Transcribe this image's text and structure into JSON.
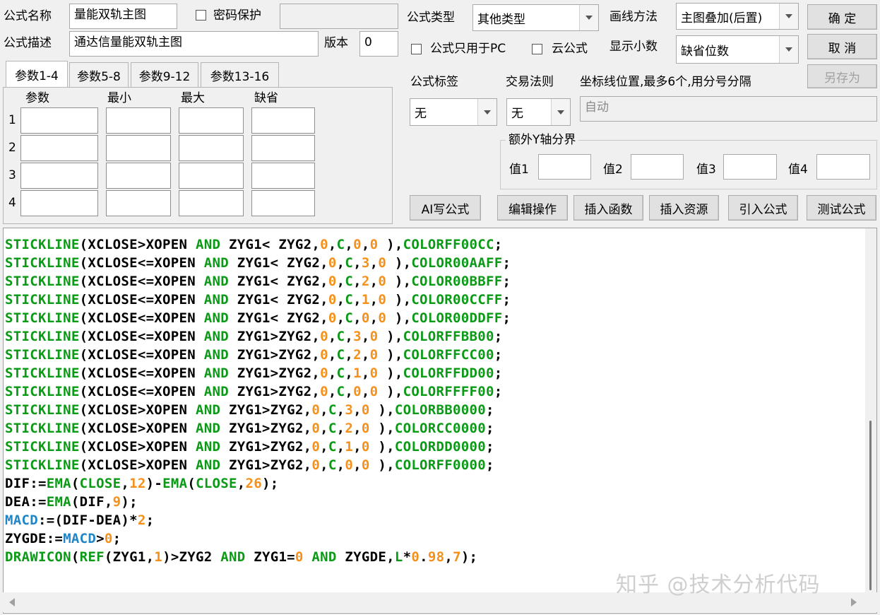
{
  "form": {
    "name_label": "公式名称",
    "name_value": "量能双轨主图",
    "password_label": "密码保护",
    "desc_label": "公式描述",
    "desc_value": "通达信量能双轨主图",
    "version_label": "版本",
    "version_value": "0",
    "type_label": "公式类型",
    "type_value": "其他类型",
    "draw_label": "画线方法",
    "draw_value": "主图叠加(后置)",
    "pc_only_label": "公式只用于PC",
    "cloud_label": "云公式",
    "decimals_label": "显示小数",
    "decimals_value": "缺省位数",
    "tag_label": "公式标签",
    "tag_value": "无",
    "rule_label": "交易法则",
    "rule_value": "无",
    "coord_label": "坐标线位置,最多6个,用分号分隔",
    "coord_placeholder": "自动",
    "extra_y_label": "额外Y轴分界",
    "val_labels": [
      "值1",
      "值2",
      "值3",
      "值4"
    ]
  },
  "buttons": {
    "ok": "确  定",
    "cancel": "取  消",
    "save_as": "另存为",
    "ai_write": "AI写公式",
    "edit_ops": "编辑操作",
    "insert_func": "插入函数",
    "insert_res": "插入资源",
    "import_formula": "引入公式",
    "test_formula": "测试公式"
  },
  "param_tabs": [
    "参数1-4",
    "参数5-8",
    "参数9-12",
    "参数13-16"
  ],
  "param_headers": [
    "参数",
    "最小",
    "最大",
    "缺省"
  ],
  "param_rows": [
    "1",
    "2",
    "3",
    "4"
  ],
  "colors": {
    "keyword": "#0a9a16",
    "number": "#f5901a",
    "text": "#000000",
    "variable": "#1f86c8"
  },
  "code_lines": [
    [
      [
        "g",
        "STICKLINE"
      ],
      [
        "k",
        "(XCLOSE>XOPEN "
      ],
      [
        "g",
        "AND"
      ],
      [
        "k",
        " ZYG1< ZYG2,"
      ],
      [
        "o",
        "0"
      ],
      [
        "k",
        ","
      ],
      [
        "g",
        "C"
      ],
      [
        "k",
        ","
      ],
      [
        "o",
        "0"
      ],
      [
        "k",
        ","
      ],
      [
        "o",
        "0"
      ],
      [
        "k",
        " ),"
      ],
      [
        "g",
        "COLORFF00CC"
      ],
      [
        "k",
        ";"
      ]
    ],
    [
      [
        "g",
        "STICKLINE"
      ],
      [
        "k",
        "(XCLOSE<=XOPEN "
      ],
      [
        "g",
        "AND"
      ],
      [
        "k",
        " ZYG1< ZYG2,"
      ],
      [
        "o",
        "0"
      ],
      [
        "k",
        ","
      ],
      [
        "g",
        "C"
      ],
      [
        "k",
        ","
      ],
      [
        "o",
        "3"
      ],
      [
        "k",
        ","
      ],
      [
        "o",
        "0"
      ],
      [
        "k",
        " ),"
      ],
      [
        "g",
        "COLOR00AAFF"
      ],
      [
        "k",
        ";"
      ]
    ],
    [
      [
        "g",
        "STICKLINE"
      ],
      [
        "k",
        "(XCLOSE<=XOPEN "
      ],
      [
        "g",
        "AND"
      ],
      [
        "k",
        " ZYG1< ZYG2,"
      ],
      [
        "o",
        "0"
      ],
      [
        "k",
        ","
      ],
      [
        "g",
        "C"
      ],
      [
        "k",
        ","
      ],
      [
        "o",
        "2"
      ],
      [
        "k",
        ","
      ],
      [
        "o",
        "0"
      ],
      [
        "k",
        " ),"
      ],
      [
        "g",
        "COLOR00BBFF"
      ],
      [
        "k",
        ";"
      ]
    ],
    [
      [
        "g",
        "STICKLINE"
      ],
      [
        "k",
        "(XCLOSE<=XOPEN "
      ],
      [
        "g",
        "AND"
      ],
      [
        "k",
        " ZYG1< ZYG2,"
      ],
      [
        "o",
        "0"
      ],
      [
        "k",
        ","
      ],
      [
        "g",
        "C"
      ],
      [
        "k",
        ","
      ],
      [
        "o",
        "1"
      ],
      [
        "k",
        ","
      ],
      [
        "o",
        "0"
      ],
      [
        "k",
        " ),"
      ],
      [
        "g",
        "COLOR00CCFF"
      ],
      [
        "k",
        ";"
      ]
    ],
    [
      [
        "g",
        "STICKLINE"
      ],
      [
        "k",
        "(XCLOSE<=XOPEN "
      ],
      [
        "g",
        "AND"
      ],
      [
        "k",
        " ZYG1< ZYG2,"
      ],
      [
        "o",
        "0"
      ],
      [
        "k",
        ","
      ],
      [
        "g",
        "C"
      ],
      [
        "k",
        ","
      ],
      [
        "o",
        "0"
      ],
      [
        "k",
        ","
      ],
      [
        "o",
        "0"
      ],
      [
        "k",
        " ),"
      ],
      [
        "g",
        "COLOR00DDFF"
      ],
      [
        "k",
        ";"
      ]
    ],
    [
      [
        "g",
        "STICKLINE"
      ],
      [
        "k",
        "(XCLOSE<=XOPEN "
      ],
      [
        "g",
        "AND"
      ],
      [
        "k",
        " ZYG1>ZYG2,"
      ],
      [
        "o",
        "0"
      ],
      [
        "k",
        ","
      ],
      [
        "g",
        "C"
      ],
      [
        "k",
        ","
      ],
      [
        "o",
        "3"
      ],
      [
        "k",
        ","
      ],
      [
        "o",
        "0"
      ],
      [
        "k",
        " ),"
      ],
      [
        "g",
        "COLORFFBB00"
      ],
      [
        "k",
        ";"
      ]
    ],
    [
      [
        "g",
        "STICKLINE"
      ],
      [
        "k",
        "(XCLOSE<=XOPEN "
      ],
      [
        "g",
        "AND"
      ],
      [
        "k",
        " ZYG1>ZYG2,"
      ],
      [
        "o",
        "0"
      ],
      [
        "k",
        ","
      ],
      [
        "g",
        "C"
      ],
      [
        "k",
        ","
      ],
      [
        "o",
        "2"
      ],
      [
        "k",
        ","
      ],
      [
        "o",
        "0"
      ],
      [
        "k",
        " ),"
      ],
      [
        "g",
        "COLORFFCC00"
      ],
      [
        "k",
        ";"
      ]
    ],
    [
      [
        "g",
        "STICKLINE"
      ],
      [
        "k",
        "(XCLOSE<=XOPEN "
      ],
      [
        "g",
        "AND"
      ],
      [
        "k",
        " ZYG1>ZYG2,"
      ],
      [
        "o",
        "0"
      ],
      [
        "k",
        ","
      ],
      [
        "g",
        "C"
      ],
      [
        "k",
        ","
      ],
      [
        "o",
        "1"
      ],
      [
        "k",
        ","
      ],
      [
        "o",
        "0"
      ],
      [
        "k",
        " ),"
      ],
      [
        "g",
        "COLORFFDD00"
      ],
      [
        "k",
        ";"
      ]
    ],
    [
      [
        "g",
        "STICKLINE"
      ],
      [
        "k",
        "(XCLOSE<=XOPEN "
      ],
      [
        "g",
        "AND"
      ],
      [
        "k",
        " ZYG1>ZYG2,"
      ],
      [
        "o",
        "0"
      ],
      [
        "k",
        ","
      ],
      [
        "g",
        "C"
      ],
      [
        "k",
        ","
      ],
      [
        "o",
        "0"
      ],
      [
        "k",
        ","
      ],
      [
        "o",
        "0"
      ],
      [
        "k",
        " ),"
      ],
      [
        "g",
        "COLORFFFF00"
      ],
      [
        "k",
        ";"
      ]
    ],
    [
      [
        "g",
        "STICKLINE"
      ],
      [
        "k",
        "(XCLOSE>XOPEN "
      ],
      [
        "g",
        "AND"
      ],
      [
        "k",
        " ZYG1>ZYG2,"
      ],
      [
        "o",
        "0"
      ],
      [
        "k",
        ","
      ],
      [
        "g",
        "C"
      ],
      [
        "k",
        ","
      ],
      [
        "o",
        "3"
      ],
      [
        "k",
        ","
      ],
      [
        "o",
        "0"
      ],
      [
        "k",
        " ),"
      ],
      [
        "g",
        "COLORBB0000"
      ],
      [
        "k",
        ";"
      ]
    ],
    [
      [
        "g",
        "STICKLINE"
      ],
      [
        "k",
        "(XCLOSE>XOPEN "
      ],
      [
        "g",
        "AND"
      ],
      [
        "k",
        " ZYG1>ZYG2,"
      ],
      [
        "o",
        "0"
      ],
      [
        "k",
        ","
      ],
      [
        "g",
        "C"
      ],
      [
        "k",
        ","
      ],
      [
        "o",
        "2"
      ],
      [
        "k",
        ","
      ],
      [
        "o",
        "0"
      ],
      [
        "k",
        " ),"
      ],
      [
        "g",
        "COLORCC0000"
      ],
      [
        "k",
        ";"
      ]
    ],
    [
      [
        "g",
        "STICKLINE"
      ],
      [
        "k",
        "(XCLOSE>XOPEN "
      ],
      [
        "g",
        "AND"
      ],
      [
        "k",
        " ZYG1>ZYG2,"
      ],
      [
        "o",
        "0"
      ],
      [
        "k",
        ","
      ],
      [
        "g",
        "C"
      ],
      [
        "k",
        ","
      ],
      [
        "o",
        "1"
      ],
      [
        "k",
        ","
      ],
      [
        "o",
        "0"
      ],
      [
        "k",
        " ),"
      ],
      [
        "g",
        "COLORDD0000"
      ],
      [
        "k",
        ";"
      ]
    ],
    [
      [
        "g",
        "STICKLINE"
      ],
      [
        "k",
        "(XCLOSE>XOPEN "
      ],
      [
        "g",
        "AND"
      ],
      [
        "k",
        " ZYG1>ZYG2,"
      ],
      [
        "o",
        "0"
      ],
      [
        "k",
        ","
      ],
      [
        "g",
        "C"
      ],
      [
        "k",
        ","
      ],
      [
        "o",
        "0"
      ],
      [
        "k",
        ","
      ],
      [
        "o",
        "0"
      ],
      [
        "k",
        " ),"
      ],
      [
        "g",
        "COLORFF0000"
      ],
      [
        "k",
        ";"
      ]
    ],
    [
      [
        "k",
        "DIF:="
      ],
      [
        "g",
        "EMA"
      ],
      [
        "k",
        "("
      ],
      [
        "g",
        "CLOSE"
      ],
      [
        "k",
        ","
      ],
      [
        "o",
        "12"
      ],
      [
        "k",
        ")-"
      ],
      [
        "g",
        "EMA"
      ],
      [
        "k",
        "("
      ],
      [
        "g",
        "CLOSE"
      ],
      [
        "k",
        ","
      ],
      [
        "o",
        "26"
      ],
      [
        "k",
        ");"
      ]
    ],
    [
      [
        "k",
        "DEA:="
      ],
      [
        "g",
        "EMA"
      ],
      [
        "k",
        "(DIF,"
      ],
      [
        "o",
        "9"
      ],
      [
        "k",
        ");"
      ]
    ],
    [
      [
        "b",
        "MACD"
      ],
      [
        "k",
        ":=(DIF-DEA)*"
      ],
      [
        "o",
        "2"
      ],
      [
        "k",
        ";"
      ]
    ],
    [
      [
        "k",
        "ZYGDE:="
      ],
      [
        "b",
        "MACD"
      ],
      [
        "k",
        ">"
      ],
      [
        "o",
        "0"
      ],
      [
        "k",
        ";"
      ]
    ],
    [
      [
        "g",
        "DRAWICON"
      ],
      [
        "k",
        "("
      ],
      [
        "g",
        "REF"
      ],
      [
        "k",
        "(ZYG1,"
      ],
      [
        "o",
        "1"
      ],
      [
        "k",
        ")>ZYG2 "
      ],
      [
        "g",
        "AND"
      ],
      [
        "k",
        " ZYG1="
      ],
      [
        "o",
        "0"
      ],
      [
        "k",
        " "
      ],
      [
        "g",
        "AND"
      ],
      [
        "k",
        " ZYGDE,"
      ],
      [
        "g",
        "L"
      ],
      [
        "k",
        "*"
      ],
      [
        "o",
        "0"
      ],
      [
        "k",
        "."
      ],
      [
        "o",
        "98"
      ],
      [
        "k",
        ","
      ],
      [
        "o",
        "7"
      ],
      [
        "k",
        ");"
      ]
    ]
  ],
  "watermark": "知乎 @技术分析代码"
}
